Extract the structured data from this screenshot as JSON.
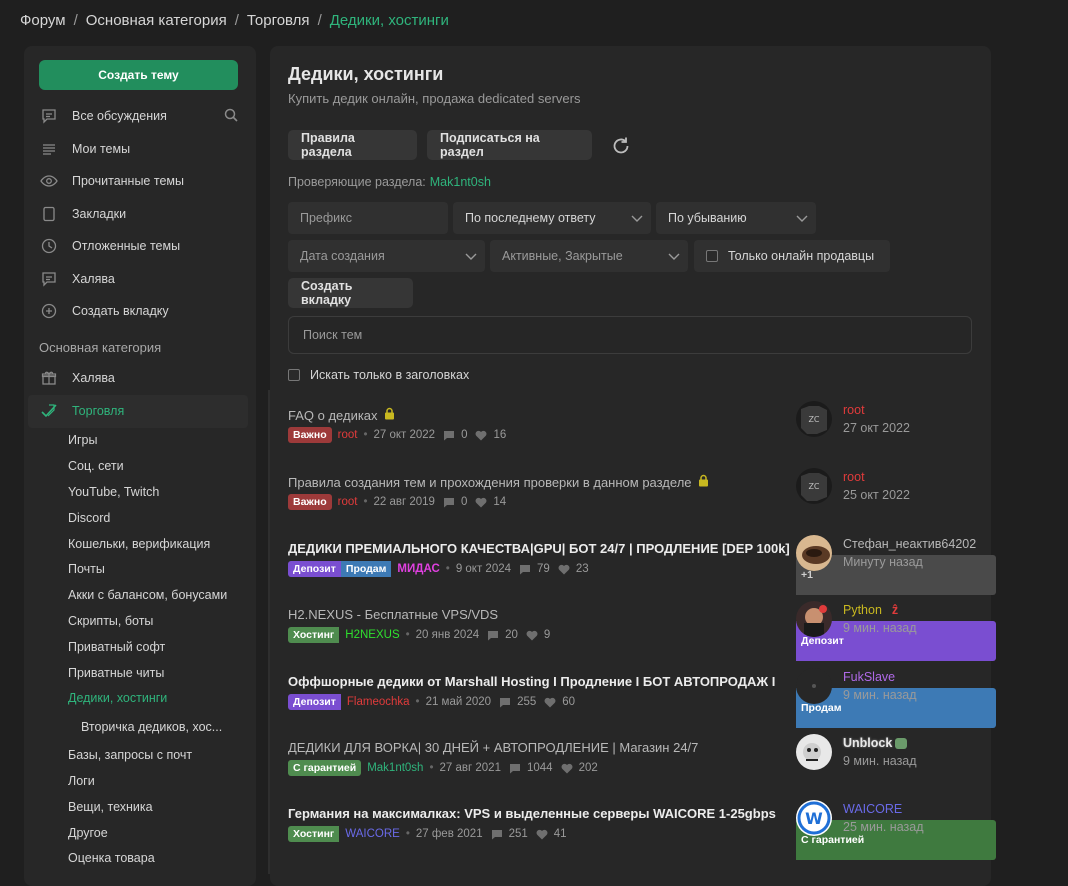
{
  "breadcrumb": {
    "items": [
      "Форум",
      "Основная категория",
      "Торговля"
    ],
    "current": "Дедики, хостинги",
    "sep": "/"
  },
  "sidebar": {
    "create_label": "Создать тему",
    "nav": [
      {
        "label": "Все обсуждения",
        "icon": "chat-icon"
      },
      {
        "label": "Мои темы",
        "icon": "list-icon"
      },
      {
        "label": "Прочитанные темы",
        "icon": "eye-icon"
      },
      {
        "label": "Закладки",
        "icon": "bookmark-icon"
      },
      {
        "label": "Отложенные темы",
        "icon": "clock-icon"
      },
      {
        "label": "Халява",
        "icon": "chat-icon"
      },
      {
        "label": "Создать вкладку",
        "icon": "plus-circle-icon"
      }
    ],
    "section_title": "Основная категория",
    "categories": [
      {
        "label": "Халява",
        "icon": "gift-icon"
      },
      {
        "label": "Торговля",
        "icon": "check-tag-icon"
      }
    ],
    "subs": [
      "Игры",
      "Соц. сети",
      "YouTube, Twitch",
      "Discord",
      "Кошельки, верификация",
      "Почты",
      "Акки с балансом, бонусами",
      "Скрипты, боты",
      "Приватный софт",
      "Приватные читы"
    ],
    "active_sub": "Дедики, хостинги",
    "deep_sub": "Вторичка дедиков, хос...",
    "subs_after": [
      "Базы, запросы с почт",
      "Логи",
      "Вещи, техника",
      "Другое",
      "Оценка товара"
    ]
  },
  "main": {
    "title": "Дедики, хостинги",
    "subtitle": "Купить дедик онлайн, продажа dedicated servers",
    "rules_btn": "Правила раздела",
    "subscribe_btn": "Подписаться на раздел",
    "moderators_label": "Проверяющие раздела:",
    "moderator": "Mak1nt0sh",
    "prefix_placeholder": "Префикс",
    "sort_by": "По последнему ответу",
    "order": "По убыванию",
    "date_created": "Дата создания",
    "state": "Активные, Закрытые",
    "online_sellers": "Только онлайн продавцы",
    "create_tab": "Создать вкладку",
    "search_placeholder": "Поиск тем",
    "only_titles": "Искать только в заголовках"
  },
  "threads": [
    {
      "title": "FAQ о дедиках",
      "locked": true,
      "style": "muted",
      "tags": [
        {
          "text": "Важно",
          "color": "red"
        }
      ],
      "author": "root",
      "author_color": "#e03b3b",
      "date": "27 окт 2022",
      "replies": "0",
      "likes": "16",
      "last_name": "root",
      "last_color": "#e03b3b",
      "last_time": "27 окт 2022",
      "avatar": "root"
    },
    {
      "title": "Правила создания тем и прохождения проверки в данном разделе",
      "locked": true,
      "style": "muted",
      "tags": [
        {
          "text": "Важно",
          "color": "red"
        }
      ],
      "author": "root",
      "author_color": "#e03b3b",
      "date": "22 авг 2019",
      "replies": "0",
      "likes": "14",
      "last_name": "root",
      "last_color": "#e03b3b",
      "last_time": "25 окт 2022",
      "avatar": "root"
    },
    {
      "title": "ДЕДИКИ ПРЕМИАЛЬНОГО КАЧЕСТВА|GPU| БОТ 24/7 | ПРОДЛЕНИЕ [DEP 100k]",
      "locked": false,
      "style": "bold",
      "tags": [
        {
          "text": "Депозит",
          "color": "purple"
        },
        {
          "text": "Продам",
          "color": "blue"
        },
        {
          "text": "+1",
          "color": "gray"
        }
      ],
      "author": "МИДАС",
      "author_color": "#e040e0",
      "date": "9 окт 2024",
      "replies": "79",
      "likes": "23",
      "last_name": "Стефан_неактив64202",
      "last_color": "#b8b8b8",
      "last_time": "Минуту назад",
      "avatar": "stefan"
    },
    {
      "title": "H2.NEXUS - Бесплатные VPS/VDS",
      "locked": false,
      "style": "muted",
      "tags": [
        {
          "text": "Хостинг",
          "color": "green"
        },
        {
          "text": "Депозит",
          "color": "purple"
        }
      ],
      "author": "H2NEXUS",
      "author_color": "#2fe02f",
      "date": "20 янв 2024",
      "replies": "20",
      "likes": "9",
      "last_name": "Python",
      "last_color": "#c8b820",
      "last_time": "9 мин. назад",
      "avatar": "python"
    },
    {
      "title": "Оффшорные дедики от Marshall Hosting I Продление I БОТ АВТОПРОДАЖ I",
      "locked": false,
      "style": "bold",
      "tags": [
        {
          "text": "Депозит",
          "color": "purple"
        },
        {
          "text": "Продам",
          "color": "blue"
        }
      ],
      "author": "Flameochka",
      "author_color": "#e03b3b",
      "date": "21 май 2020",
      "replies": "255",
      "likes": "60",
      "last_name": "FukSlave",
      "last_color": "#b06ae8",
      "last_time": "9 мин. назад",
      "avatar": "fuk"
    },
    {
      "title": "ДЕДИКИ ДЛЯ ВОРКА| 30 ДНЕЙ + АВТОПРОДЛЕНИЕ | Магазин 24/7",
      "locked": false,
      "style": "muted",
      "tags": [
        {
          "text": "С гарантией",
          "color": "green"
        }
      ],
      "author": "Mak1nt0sh",
      "author_color": "#2fb47c",
      "date": "27 авг 2021",
      "replies": "1044",
      "likes": "202",
      "last_name": "Unblock",
      "last_color": "#e8e8e8",
      "last_time": "9 мин. назад",
      "avatar": "unblock"
    },
    {
      "title": "Германия на максималках: VPS и выделенные серверы WAICORE 1-25gbps",
      "locked": false,
      "style": "bold",
      "tags": [
        {
          "text": "Хостинг",
          "color": "green"
        },
        {
          "text": "С гарантией",
          "color": "green"
        }
      ],
      "author": "WAICORE",
      "author_color": "#6a6ae8",
      "date": "27 фев 2021",
      "replies": "251",
      "likes": "41",
      "last_name": "WAICORE",
      "last_color": "#6a6ae8",
      "last_time": "25 мин. назад",
      "avatar": "waicore"
    }
  ]
}
